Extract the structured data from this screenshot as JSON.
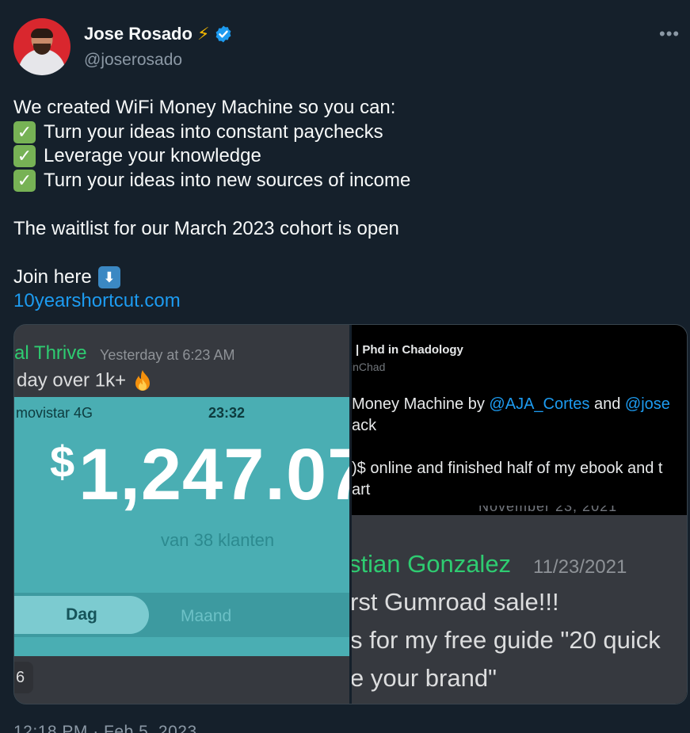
{
  "author": {
    "name": "Jose Rosado",
    "handle": "@joserosado",
    "more_label": "•••"
  },
  "tweet": {
    "intro": "We created WiFi Money Machine so you can:",
    "bullets": [
      "Turn your ideas into constant paychecks",
      "Leverage your knowledge",
      "Turn your ideas into new sources of income"
    ],
    "waitlist": "The waitlist for our March 2023 cohort is open",
    "join": "Join here",
    "link": "10yearshortcut.com",
    "timestamp": "12:18 PM · Feb 5, 2023"
  },
  "media": {
    "left": {
      "discord_name": "al Thrive",
      "discord_time": "Yesterday at 6:23 AM",
      "discord_msg": "day over 1k+",
      "carrier": "movistar  4G",
      "clock": "23:32",
      "dollar": "$",
      "amount": "1,247.07",
      "klanten": "van 38 klanten",
      "tab_dag": "Dag",
      "tab_maand": "Maand",
      "chip": "6"
    },
    "right": {
      "tw_name": "| Phd in Chadology",
      "tw_handle": "inChad",
      "tw_l1_a": "Money Machine by ",
      "tw_l1_m1": "@AJA_Cortes",
      "tw_l1_b": " and ",
      "tw_l1_m2": "@jose",
      "tw_l2": "ack",
      "tw_l3": ")$ online and finished half of my ebook and t",
      "tw_l4": "art",
      "date_peek": "November 23, 2021",
      "d2_name": "stian Gonzalez",
      "d2_date": "11/23/2021",
      "d2_l1": "rst Gumroad sale!!!",
      "d2_l2": "s for my free guide \"20 quick",
      "d2_l3": "e your brand\""
    }
  },
  "colors": {
    "background": "#15202b",
    "link": "#1d9bf0",
    "verified": "#1d9bf0",
    "discord_green": "#2ecc71",
    "phone_teal": "#4aaeb3"
  },
  "icons": [
    "lightning-icon",
    "verified-badge-icon",
    "check-mark-icon",
    "down-arrow-icon",
    "fire-icon"
  ]
}
